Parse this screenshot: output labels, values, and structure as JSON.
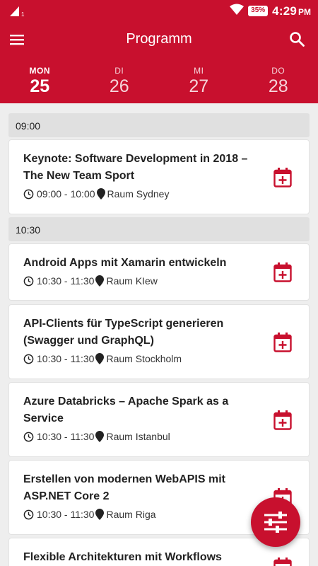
{
  "status_bar": {
    "time": "4:29",
    "ampm": "PM",
    "battery": "35%",
    "network": "1"
  },
  "app_bar": {
    "title": "Programm",
    "menu_icon": "menu-icon",
    "search_icon": "search-icon"
  },
  "days": [
    {
      "name": "MON",
      "date": "25",
      "active": true
    },
    {
      "name": "DI",
      "date": "26",
      "active": false
    },
    {
      "name": "MI",
      "date": "27",
      "active": false
    },
    {
      "name": "DO",
      "date": "28",
      "active": false
    }
  ],
  "slots": [
    {
      "time": "09:00",
      "sessions": [
        {
          "title": "Keynote: Software Development in 2018 – The New Team Sport",
          "time": "09:00 - 10:00",
          "room": "Raum Sydney"
        }
      ]
    },
    {
      "time": "10:30",
      "sessions": [
        {
          "title": "Android Apps mit Xamarin entwickeln",
          "time": "10:30 - 11:30",
          "room": "Raum KIew"
        },
        {
          "title": "API-Clients für TypeScript generieren (Swagger und GraphQL)",
          "time": "10:30 - 11:30",
          "room": "Raum Stockholm"
        },
        {
          "title": "Azure Databricks – Apache Spark as a Service",
          "time": "10:30 - 11:30",
          "room": "Raum Istanbul"
        },
        {
          "title": "Erstellen von modernen WebAPIS mit ASP.NET Core 2",
          "time": "10:30 - 11:30",
          "room": "Raum Riga"
        },
        {
          "title": "Flexible Architekturen mit Workflows",
          "time": "",
          "room": ""
        }
      ]
    }
  ],
  "colors": {
    "brand": "#c8102e",
    "background": "#eeeeee",
    "slot_header": "#e0e0e0"
  },
  "fab": {
    "icon": "filter-sliders-icon"
  }
}
